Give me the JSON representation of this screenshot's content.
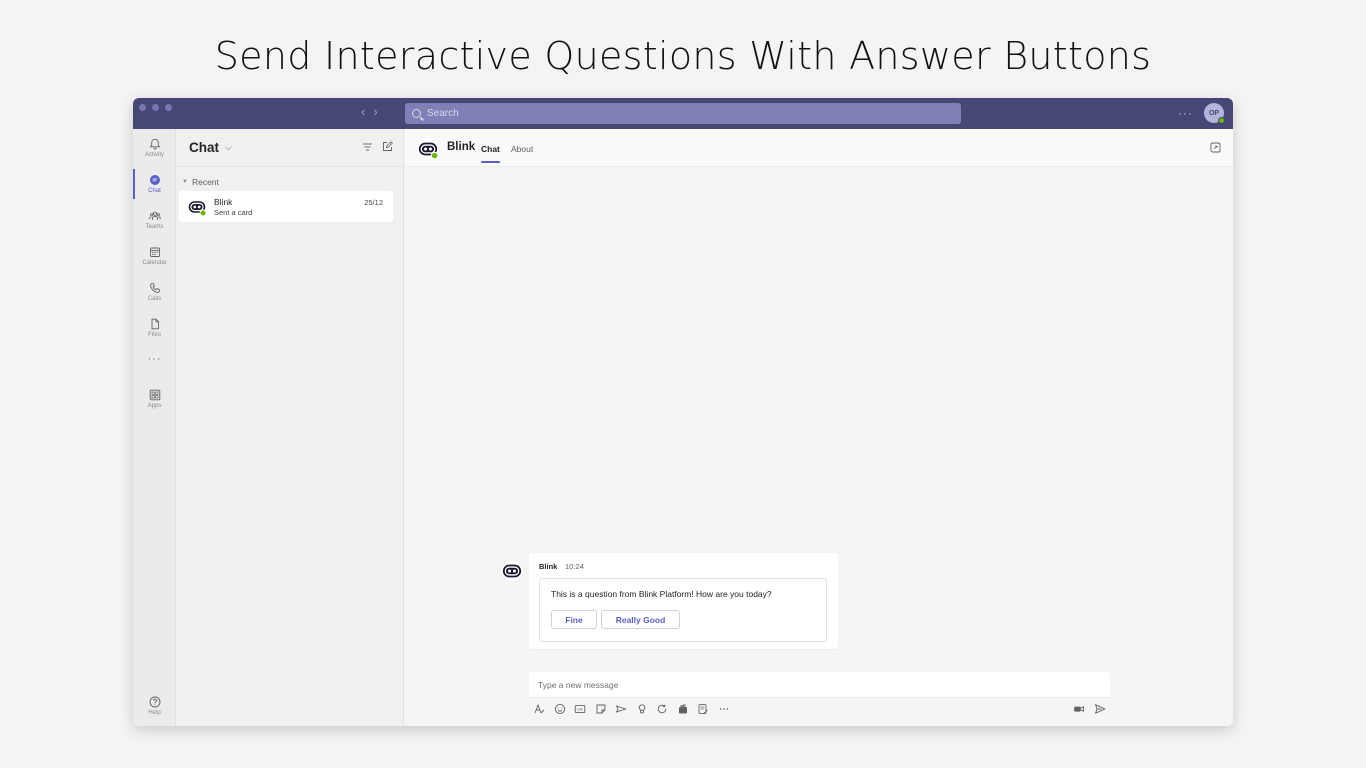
{
  "headline": "Send Interactive Questions With Answer Buttons",
  "titlebar": {
    "search_placeholder": "Search",
    "more": "···",
    "avatar_initials": "OP"
  },
  "rail": {
    "items": [
      {
        "label": "Activity",
        "icon": "bell-icon"
      },
      {
        "label": "Chat",
        "icon": "chat-icon",
        "active": true
      },
      {
        "label": "Teams",
        "icon": "teams-icon"
      },
      {
        "label": "Calendar",
        "icon": "calendar-icon"
      },
      {
        "label": "Calls",
        "icon": "phone-icon"
      },
      {
        "label": "Files",
        "icon": "file-icon"
      }
    ],
    "more": "···",
    "apps_label": "Apps",
    "help_label": "Help"
  },
  "chatlist": {
    "title": "Chat",
    "section": "Recent",
    "items": [
      {
        "name": "Blink",
        "preview": "Sent a card",
        "date": "25/12"
      }
    ]
  },
  "main": {
    "contact_name": "Blink",
    "tabs": [
      {
        "label": "Chat",
        "active": true
      },
      {
        "label": "About",
        "active": false
      }
    ]
  },
  "message": {
    "sender": "Blink",
    "time": "10:24",
    "card": {
      "text": "This is a question from Blink Platform! How are you today?",
      "buttons": [
        "Fine",
        "Really Good"
      ]
    }
  },
  "compose": {
    "placeholder": "Type a new message"
  },
  "colors": {
    "titlebar": "#464775",
    "accent": "#5b5fc7",
    "presence": "#6bb700"
  }
}
